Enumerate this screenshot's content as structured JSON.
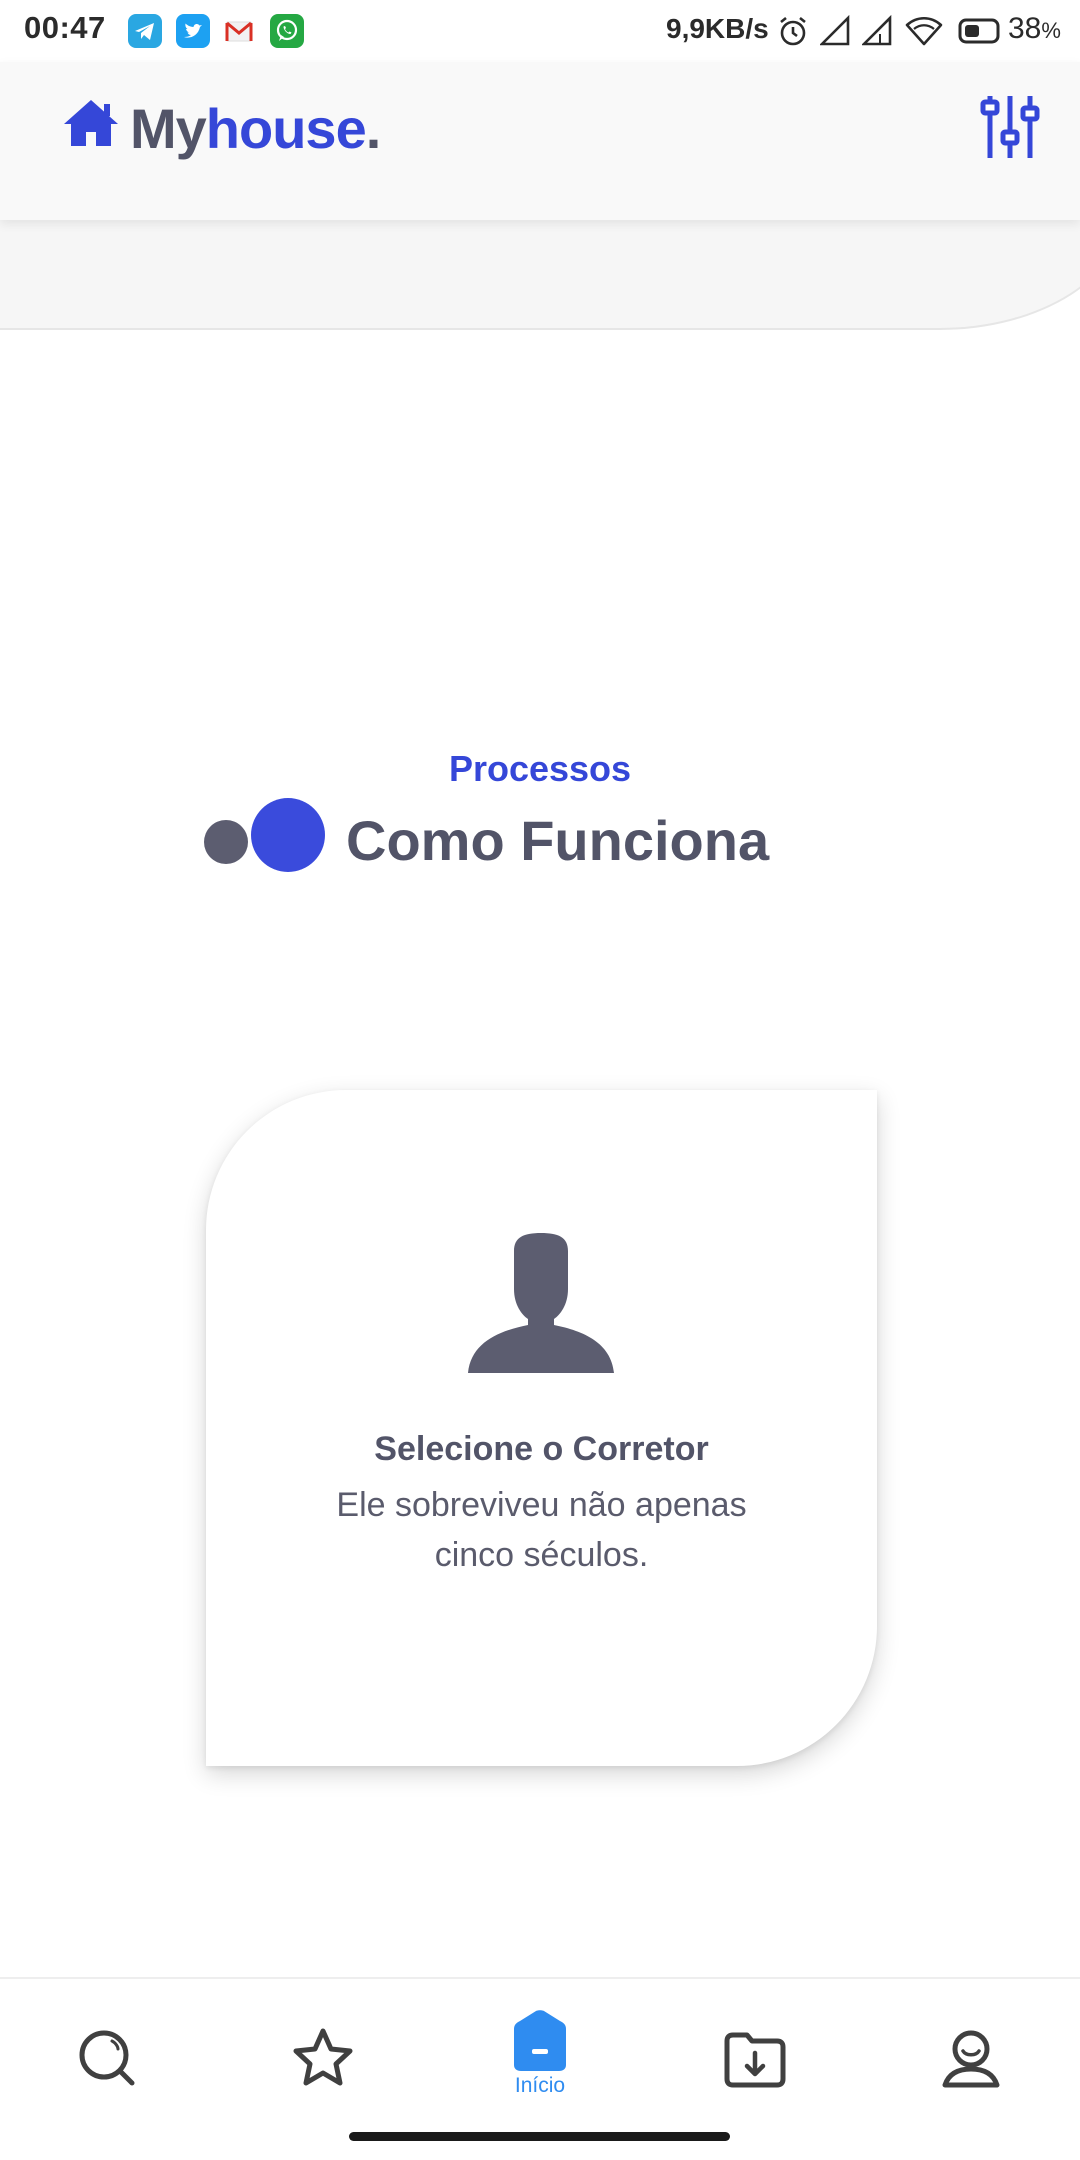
{
  "status_bar": {
    "time": "00:47",
    "network_speed": "9,9KB/s",
    "battery_level": "38",
    "battery_unit": "%",
    "notification_apps": [
      "telegram-icon",
      "twitter-icon",
      "gmail-icon",
      "whatsapp-icon"
    ]
  },
  "header": {
    "logo_my": "My",
    "logo_house": "house",
    "logo_dot": ".",
    "filter_icon": "sliders-icon"
  },
  "section": {
    "kicker": "Processos",
    "title": "Como Funciona"
  },
  "card": {
    "icon": "person-icon",
    "title": "Selecione o Corretor",
    "description": "Ele sobreviveu não apenas cinco séculos."
  },
  "bottom_nav": {
    "items": [
      {
        "icon": "search-icon"
      },
      {
        "icon": "star-icon"
      },
      {
        "icon": "home-icon",
        "label": "Início",
        "active": true
      },
      {
        "icon": "download-folder-icon"
      },
      {
        "icon": "profile-icon"
      }
    ]
  },
  "colors": {
    "accent": "#3547d8",
    "text_dark": "#525468",
    "nav_active": "#2f8cf0"
  }
}
